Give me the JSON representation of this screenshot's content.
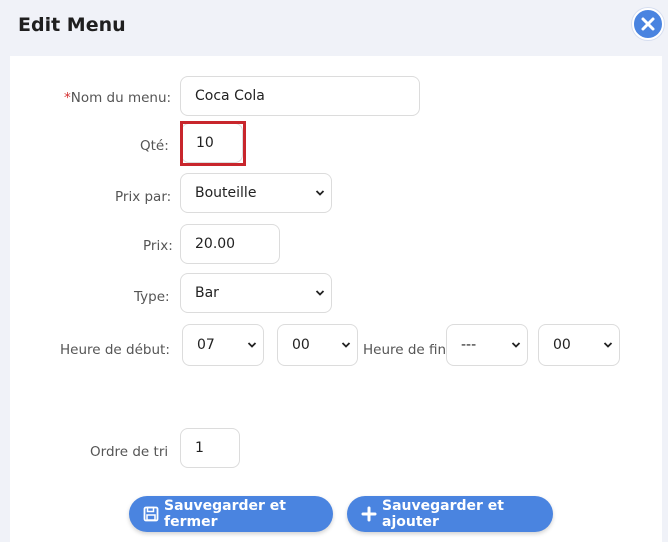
{
  "dialog": {
    "title": "Edit Menu"
  },
  "form": {
    "name": {
      "required_mark": "*",
      "label": "Nom du menu:",
      "value": "Coca Cola"
    },
    "qty": {
      "label": "Qté:",
      "value": "10"
    },
    "price_per": {
      "label": "Prix par:",
      "value": "Bouteille"
    },
    "price": {
      "label": "Prix:",
      "value": "20.00"
    },
    "type": {
      "label": "Type:",
      "value": "Bar"
    },
    "start_time": {
      "label": "Heure de début:",
      "hour": "07",
      "minute": "00"
    },
    "end_time": {
      "label": "Heure de fin",
      "hour": "---",
      "minute": "00"
    },
    "sort_order": {
      "label": "Ordre de tri",
      "value": "1"
    }
  },
  "actions": {
    "save_close": "Sauvegarder et fermer",
    "save_add": "Sauvegarder et ajouter"
  },
  "colors": {
    "accent": "#4a84e0",
    "highlight": "#c8262c",
    "required": "#d32f2f"
  },
  "icons": {
    "close": "close-icon",
    "save": "floppy-disk-icon",
    "add": "plus-icon",
    "dropdown": "chevron-down-icon"
  }
}
